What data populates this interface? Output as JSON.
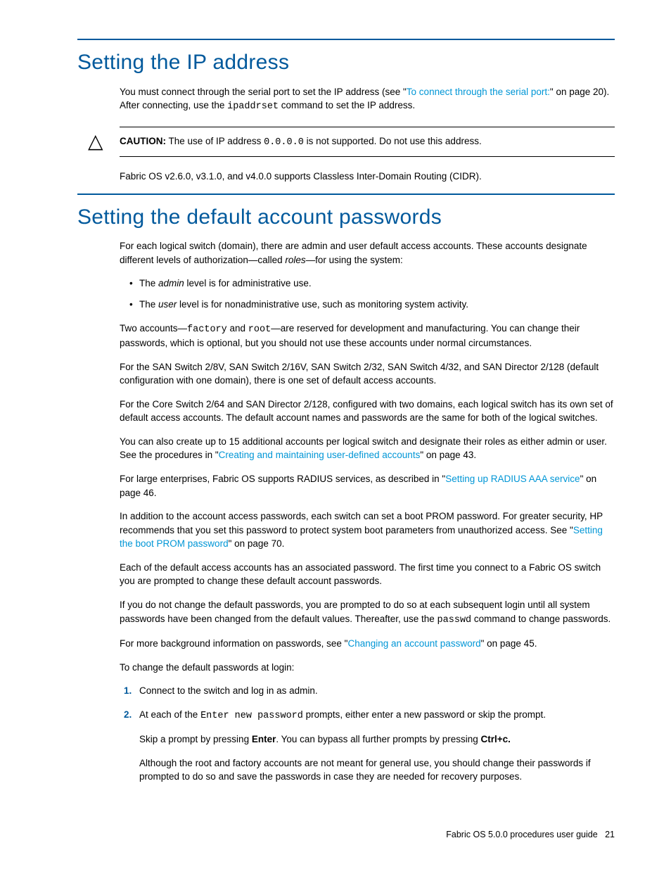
{
  "section1": {
    "title": "Setting the IP address",
    "p1a": "You must connect through the serial port to set the IP address (see \"",
    "p1link": "To connect through the serial port:",
    "p1b": "\" on page 20). After connecting, use the ",
    "p1cmd": "ipaddrset",
    "p1c": " command to set the IP address.",
    "cautionLabel": "CAUTION:",
    "cautionA": "   The use of IP address ",
    "cautionCmd": "0.0.0.0",
    "cautionB": " is not supported. Do not use this address.",
    "p2": "Fabric OS v2.6.0, v3.1.0, and v4.0.0 supports Classless Inter-Domain Routing (CIDR)."
  },
  "section2": {
    "title": "Setting the default account passwords",
    "p1a": "For each logical switch (domain), there are admin and user default access accounts. These accounts designate different levels of authorization—called ",
    "p1i": "roles",
    "p1b": "—for using the system:",
    "b1a": "The ",
    "b1i": "admin",
    "b1b": " level is for administrative use.",
    "b2a": "The ",
    "b2i": "user",
    "b2b": " level is for nonadministrative use, such as monitoring system activity.",
    "p2a": "Two accounts—",
    "p2c1": "factory",
    "p2b": " and ",
    "p2c2": "root",
    "p2c": "—are reserved for development and manufacturing. You can change their passwords, which is optional, but you should not use these accounts under normal circumstances.",
    "p3": "For the SAN Switch 2/8V, SAN Switch 2/16V, SAN Switch 2/32, SAN Switch 4/32, and SAN Director 2/128 (default configuration with one domain), there is one set of default access accounts.",
    "p4": "For the Core Switch 2/64 and SAN Director 2/128, configured with two domains, each logical switch has its own set of default access accounts. The default account names and passwords are the same for both of the logical switches.",
    "p5a": "You can also create up to 15 additional accounts per logical switch and designate their roles as either admin or user. See the procedures in \"",
    "p5link": "Creating and maintaining user-defined accounts",
    "p5b": "\" on page 43.",
    "p6a": "For large enterprises, Fabric OS supports RADIUS services, as described in \"",
    "p6link": "Setting up RADIUS AAA service",
    "p6b": "\" on page 46.",
    "p7a": "In addition to the account access passwords, each switch can set a boot PROM password. For greater security, HP recommends that you set this password to protect system boot parameters from unauthorized access. See \"",
    "p7link": "Setting the boot PROM password",
    "p7b": "\" on page 70.",
    "p8": "Each of the default access accounts has an associated password. The first time you connect to a Fabric OS switch you are prompted to change these default account passwords.",
    "p9a": "If you do not change the default passwords, you are prompted to do so at each subsequent login until all system passwords have been changed from the default values. Thereafter, use the ",
    "p9cmd": "passwd",
    "p9b": " command to change passwords.",
    "p10a": "For more background information on passwords, see \"",
    "p10link": "Changing an account password",
    "p10b": "\" on page 45.",
    "p11": "To change the default passwords at login:",
    "s1": "Connect to the switch and log in as admin.",
    "s2a": "At each of the ",
    "s2cmd": "Enter new password",
    "s2b": " prompts, either enter a new password or skip the prompt.",
    "s2sub1a": "Skip a prompt by pressing ",
    "s2sub1b": "Enter",
    "s2sub1c": ". You can bypass all further prompts by pressing ",
    "s2sub1d": "Ctrl+c.",
    "s2sub2": "Although the root and factory accounts are not meant for general use, you should change their passwords if prompted to do so and save the passwords in case they are needed for recovery purposes."
  },
  "footer": {
    "text": "Fabric OS 5.0.0 procedures user guide",
    "pageNum": "21"
  }
}
